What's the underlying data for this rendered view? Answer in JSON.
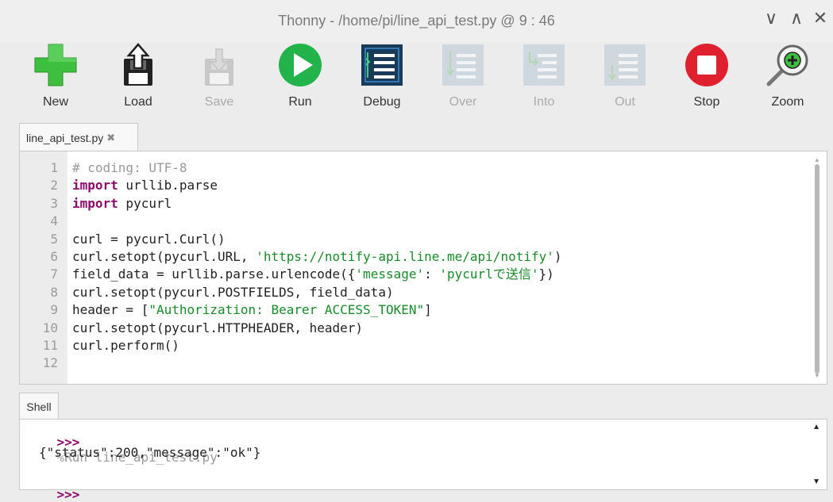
{
  "window": {
    "title": "Thonny  -  /home/pi/line_api_test.py  @  9 : 46",
    "controls": {
      "minimize": "∨",
      "maximize": "∧",
      "close": "✕"
    }
  },
  "toolbar": {
    "new": "New",
    "load": "Load",
    "save": "Save",
    "run": "Run",
    "debug": "Debug",
    "over": "Over",
    "into": "Into",
    "out": "Out",
    "stop": "Stop",
    "zoom": "Zoom"
  },
  "editor": {
    "tab_label": "line_api_test.py",
    "tab_close": "✖",
    "line_numbers": [
      "1",
      "2",
      "3",
      "4",
      "5",
      "6",
      "7",
      "8",
      "9",
      "10",
      "11",
      "12"
    ]
  },
  "code": {
    "l1": "# coding: UTF-8",
    "l2_kw": "import",
    "l2_rest": " urllib.parse",
    "l3_kw": "import",
    "l3_rest": " pycurl",
    "l5": "curl = pycurl.Curl()",
    "l6_a": "curl.setopt(pycurl.URL, ",
    "l6_s": "'https://notify-api.line.me/api/notify'",
    "l6_b": ")",
    "l7_a": "field_data = urllib.parse.urlencode({",
    "l7_s1": "'message'",
    "l7_b": ": ",
    "l7_s2": "'pycurlで送信'",
    "l7_c": "})",
    "l8": "curl.setopt(pycurl.POSTFIELDS, field_data)",
    "l9_a": "header = [",
    "l9_s": "\"Authorization: Bearer ACCESS_TOKEN\"",
    "l9_b": "]",
    "l10": "curl.setopt(pycurl.HTTPHEADER, header)",
    "l11": "curl.perform()"
  },
  "shell": {
    "tab_label": "Shell",
    "prompt": ">>>",
    "run_command": "%Run line_api_test.py",
    "output": "{\"status\":200,\"message\":\"ok\"}"
  },
  "colors": {
    "keyword": "#8a0b6b",
    "string": "#1a8a2a",
    "comment": "#9a9a9a",
    "new_green": "#3fbf3f",
    "run_green": "#22b34a",
    "stop_red": "#e0202e",
    "debug_blue": "#1a3a5a"
  }
}
